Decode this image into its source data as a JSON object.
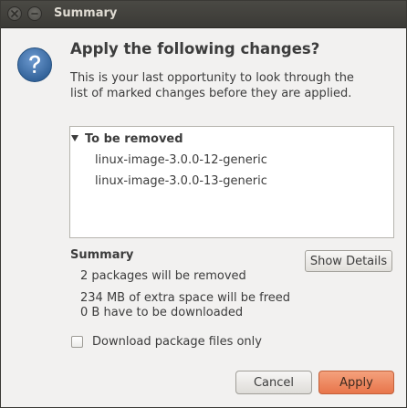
{
  "window": {
    "title": "Summary"
  },
  "dialog": {
    "heading": "Apply the following changes?",
    "description": "This is your last opportunity to look through the list of marked changes before they are applied.",
    "icon": "question-icon"
  },
  "changes": {
    "group_label": "To be removed",
    "expanded": true,
    "items": [
      "linux-image-3.0.0-12-generic",
      "linux-image-3.0.0-13-generic"
    ]
  },
  "summary": {
    "label": "Summary",
    "lines": [
      "2 packages will be removed",
      "234 MB of extra space will be freed",
      "0  B have to be downloaded"
    ],
    "show_details_label": "Show Details"
  },
  "options": {
    "download_only_label": "Download package files only",
    "download_only_checked": false
  },
  "buttons": {
    "cancel_label": "Cancel",
    "apply_label": "Apply"
  },
  "colors": {
    "accent": "#e8754b",
    "titlebar": "#3c3b37",
    "icon_blue": "#3a6ea5"
  }
}
